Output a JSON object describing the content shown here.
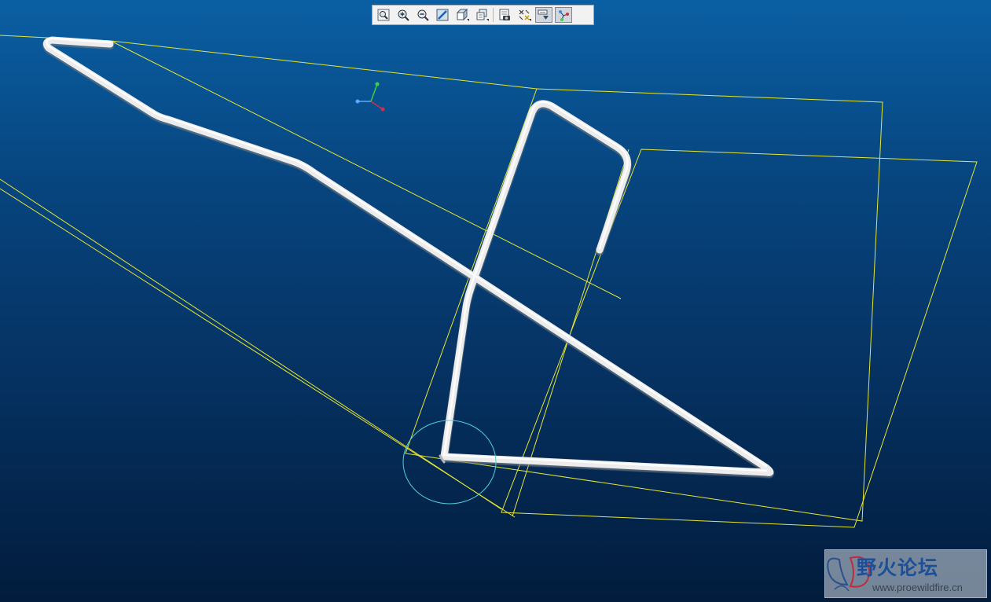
{
  "window": {
    "background_top": "#0a5fa3",
    "background_bottom": "#021c3c"
  },
  "toolbar": {
    "buttons": [
      {
        "name": "refit-button",
        "icon": "zoom-fit-icon",
        "active": false
      },
      {
        "name": "zoom-in-button",
        "icon": "zoom-in-icon",
        "active": false
      },
      {
        "name": "zoom-out-button",
        "icon": "zoom-out-icon",
        "active": false
      },
      {
        "name": "repaint-button",
        "icon": "repaint-icon",
        "active": false
      },
      {
        "name": "display-style-button",
        "icon": "display-style-cube-icon",
        "active": false,
        "flyout": true
      },
      {
        "name": "saved-views-button",
        "icon": "saved-views-icon",
        "active": false,
        "flyout": true
      },
      {
        "name": "view-manager-button",
        "icon": "view-manager-icon",
        "active": false
      },
      {
        "name": "datum-display-button",
        "icon": "datum-display-filters-icon",
        "active": false,
        "flyout": true
      },
      {
        "name": "annotation-display-button",
        "icon": "annotation-display-icon",
        "active": true
      },
      {
        "name": "spin-center-button",
        "icon": "spin-center-icon",
        "active": true
      }
    ]
  },
  "scene": {
    "datum_color": "#e6e633",
    "selection_color": "#4fd1d8",
    "wire_color": "#f2f2f2",
    "triad": {
      "x_color": "#d22d4a",
      "y_color": "#3ad04a",
      "z_color": "#5aa8ff"
    }
  },
  "watermark": {
    "title": "野火论坛",
    "url": "www.proewildfire.cn",
    "logo": "butterfly-logo-icon"
  }
}
